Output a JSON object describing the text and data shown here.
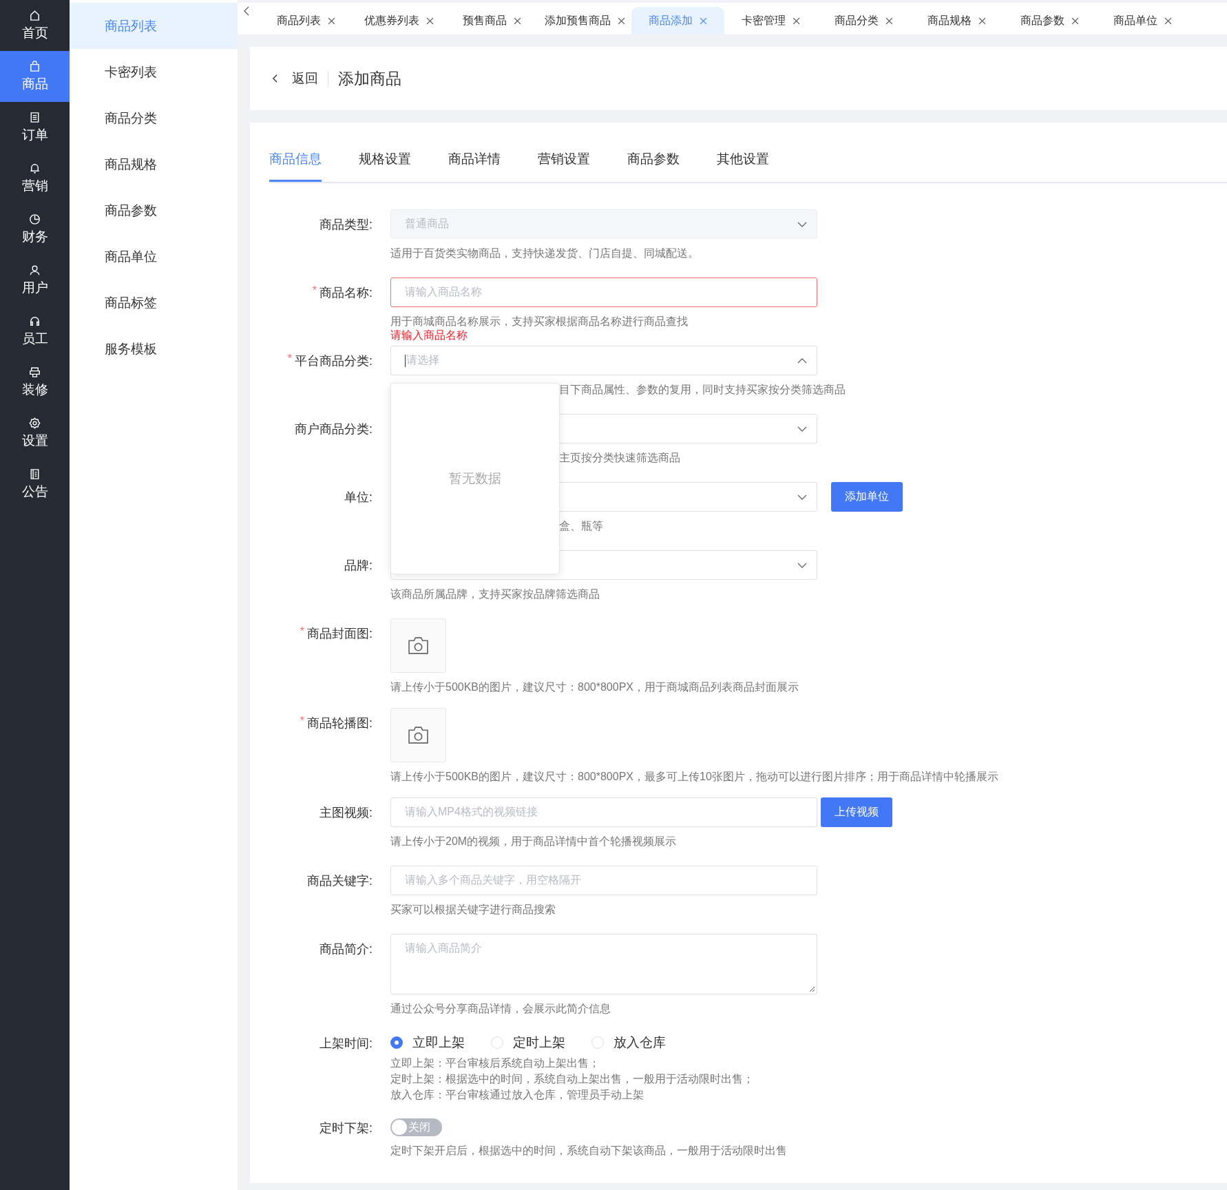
{
  "nav_rail": [
    {
      "label": "首页",
      "selected": false
    },
    {
      "label": "商品",
      "selected": true
    },
    {
      "label": "订单",
      "selected": false
    },
    {
      "label": "营销",
      "selected": false
    },
    {
      "label": "财务",
      "selected": false
    },
    {
      "label": "用户",
      "selected": false
    },
    {
      "label": "员工",
      "selected": false
    },
    {
      "label": "装修",
      "selected": false
    },
    {
      "label": "设置",
      "selected": false
    },
    {
      "label": "公告",
      "selected": false
    }
  ],
  "submenu": [
    {
      "label": "商品列表",
      "selected": true
    },
    {
      "label": "卡密列表",
      "selected": false
    },
    {
      "label": "商品分类",
      "selected": false
    },
    {
      "label": "商品规格",
      "selected": false
    },
    {
      "label": "商品参数",
      "selected": false
    },
    {
      "label": "商品单位",
      "selected": false
    },
    {
      "label": "商品标签",
      "selected": false
    },
    {
      "label": "服务模板",
      "selected": false
    }
  ],
  "tab_bar": [
    {
      "label": "商品列表",
      "selected": false
    },
    {
      "label": "优惠券列表",
      "selected": false
    },
    {
      "label": "预售商品",
      "selected": false
    },
    {
      "label": "添加预售商品",
      "selected": false
    },
    {
      "label": "商品添加",
      "selected": true
    },
    {
      "label": "卡密管理",
      "selected": false
    },
    {
      "label": "商品分类",
      "selected": false
    },
    {
      "label": "商品规格",
      "selected": false
    },
    {
      "label": "商品参数",
      "selected": false
    },
    {
      "label": "商品单位",
      "selected": false
    }
  ],
  "page_header": {
    "back": "返回",
    "title": "添加商品"
  },
  "form_tabs": [
    {
      "label": "商品信息",
      "selected": true
    },
    {
      "label": "规格设置",
      "selected": false
    },
    {
      "label": "商品详情",
      "selected": false
    },
    {
      "label": "营销设置",
      "selected": false
    },
    {
      "label": "商品参数",
      "selected": false
    },
    {
      "label": "其他设置",
      "selected": false
    }
  ],
  "form": [
    {
      "kind": "select",
      "label": "商品类型:",
      "disabled": true,
      "placeholder": "普通商品",
      "hint": "适用于百货类实物商品，支持快递发货、门店自提、同城配送。"
    },
    {
      "kind": "input",
      "label": "商品名称:",
      "required_mark": "*",
      "invalid": true,
      "placeholder": "请输入商品名称",
      "hint": "用于商城商品名称展示，支持买家根据商品名称进行商品查找",
      "error": "请输入商品名称"
    },
    {
      "kind": "select",
      "label": "平台商品分类:",
      "required_mark": "*",
      "expanded": true,
      "placeholder": "请选择",
      "hint": "目下商品属性、参数的复用，同时支持买家按分类筛选商品",
      "hint_covered": true,
      "popup": {
        "empty_text": "暂无数据"
      }
    },
    {
      "kind": "select",
      "label": "商户商品分类:",
      "hint": "主页按分类快速筛选商品",
      "hint_covered": true
    },
    {
      "kind": "select",
      "label": "单位:",
      "hint": "盒、瓶等",
      "hint_covered": true,
      "button": "添加单位"
    },
    {
      "kind": "select",
      "label": "品牌:",
      "hint": "该商品所属品牌，支持买家按品牌筛选商品"
    },
    {
      "kind": "upload",
      "label": "商品封面图:",
      "required_mark": "*",
      "hint": "请上传小于500KB的图片，建议尺寸：800*800PX，用于商城商品列表商品封面展示"
    },
    {
      "kind": "upload",
      "label": "商品轮播图:",
      "required_mark": "*",
      "hint": "请上传小于500KB的图片，建议尺寸：800*800PX，最多可上传10张图片，拖动可以进行图片排序；用于商品详情中轮播展示"
    },
    {
      "kind": "input",
      "label": "主图视频:",
      "placeholder": "请输入MP4格式的视频链接",
      "hint": "请上传小于20M的视频，用于商品详情中首个轮播视频展示",
      "button": "上传视频"
    },
    {
      "kind": "input",
      "label": "商品关键字:",
      "placeholder": "请输入多个商品关键字，用空格隔开",
      "hint": "买家可以根据关键字进行商品搜索"
    },
    {
      "kind": "textarea",
      "label": "商品简介:",
      "placeholder": "请输入商品简介",
      "hint": "通过公众号分享商品详情，会展示此简介信息"
    },
    {
      "kind": "radio",
      "label": "上架时间:",
      "options": [
        {
          "label": "立即上架",
          "selected": true
        },
        {
          "label": "定时上架",
          "selected": false
        },
        {
          "label": "放入仓库",
          "selected": false
        }
      ],
      "hint_lines": [
        "立即上架：平台审核后系统自动上架出售；",
        "定时上架：根据选中的时间，系统自动上架出售，一般用于活动限时出售；",
        "放入仓库：平台审核通过放入仓库，管理员手动上架"
      ]
    },
    {
      "kind": "switch",
      "label": "定时下架:",
      "on": false,
      "text": "关闭",
      "hint": "定时下架开启后，根据选中的时间，系统自动下架该商品，一般用于活动限时出售"
    }
  ]
}
